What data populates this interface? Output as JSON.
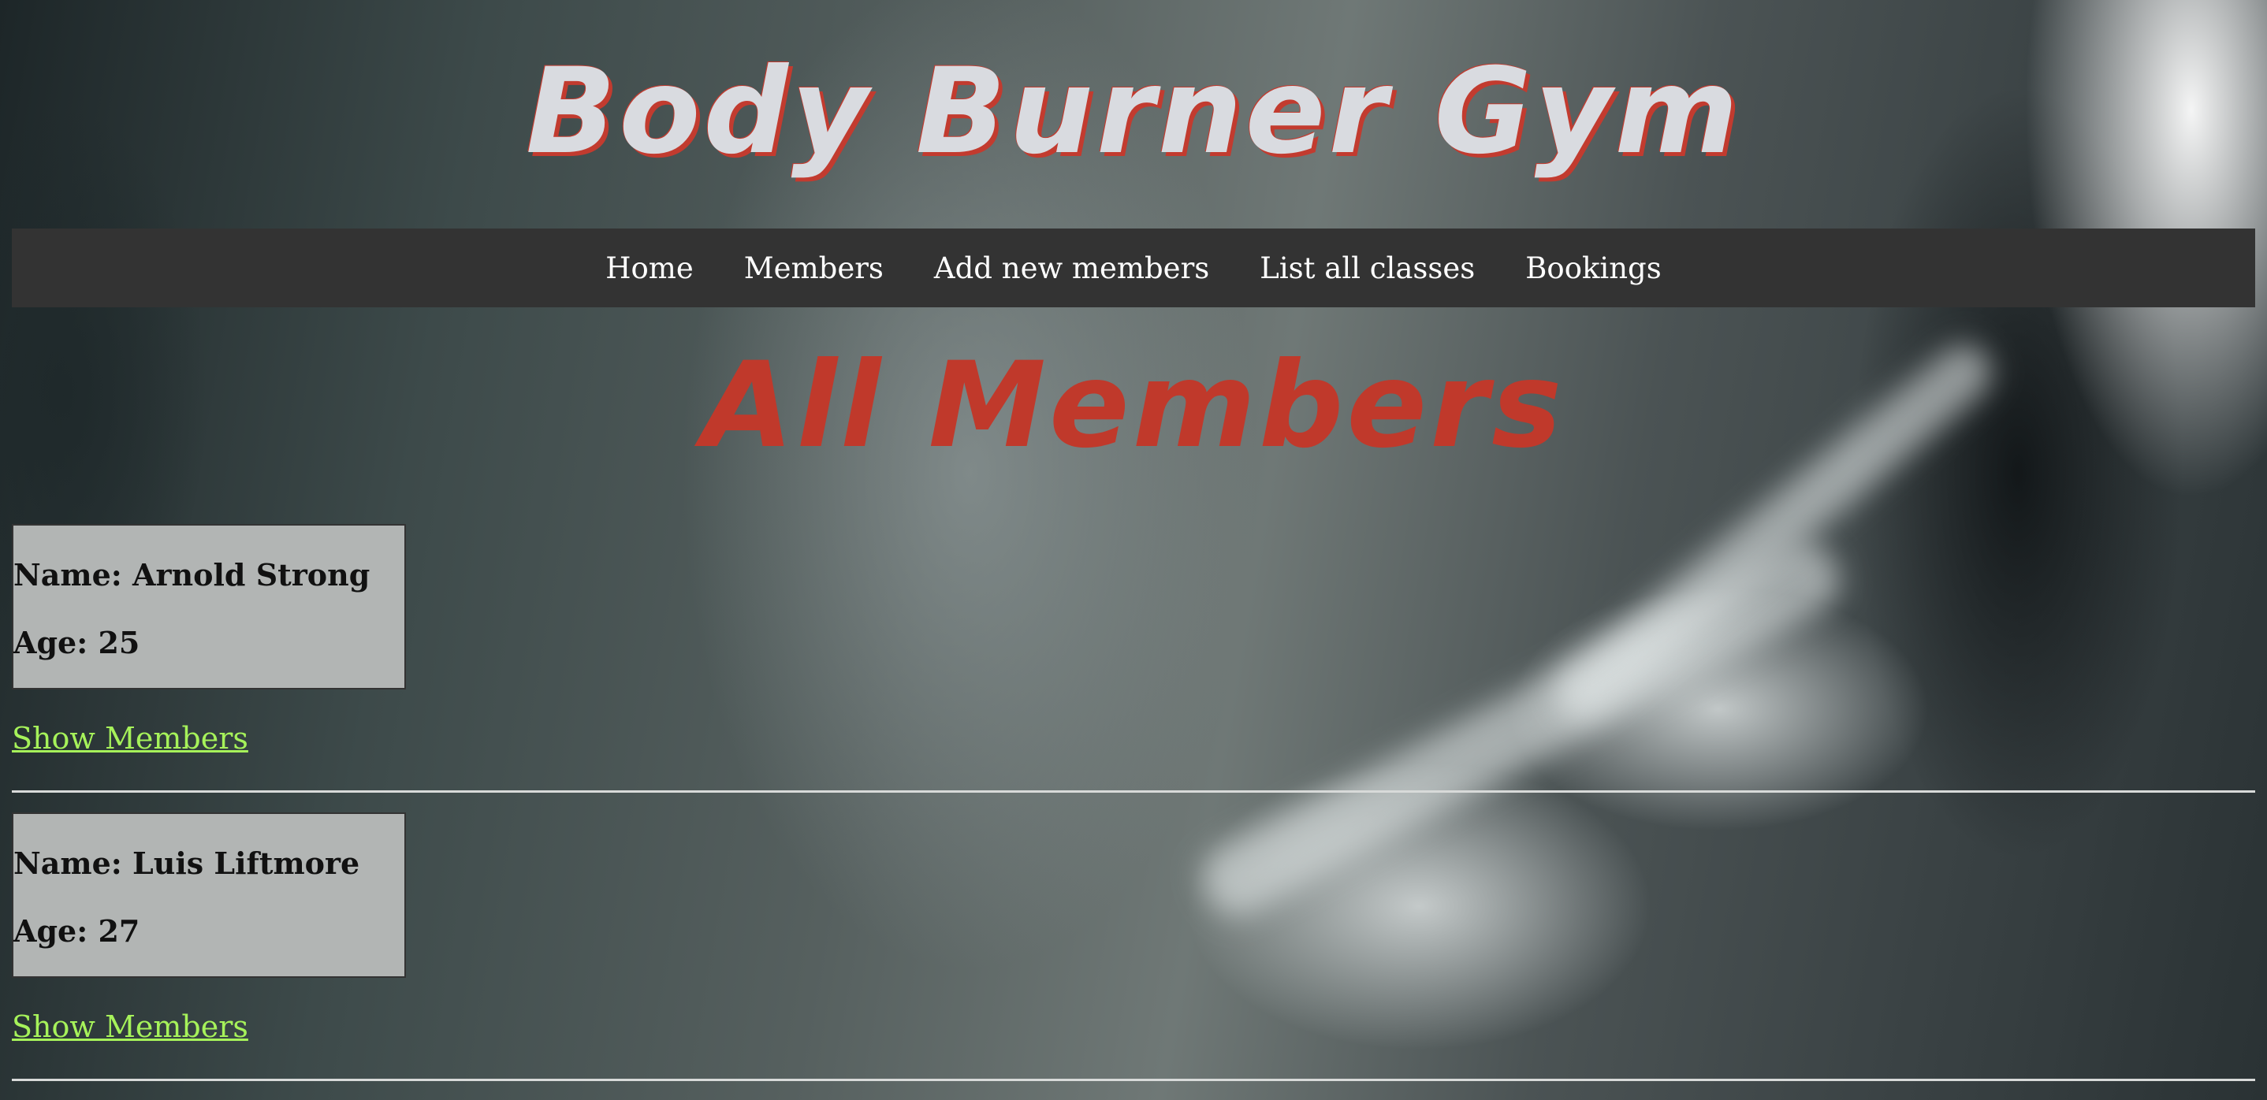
{
  "header": {
    "title": "Body Burner Gym"
  },
  "nav": {
    "items": [
      {
        "label": "Home"
      },
      {
        "label": "Members"
      },
      {
        "label": "Add new members"
      },
      {
        "label": "List all classes"
      },
      {
        "label": "Bookings"
      }
    ]
  },
  "main": {
    "heading": "All Members",
    "members": [
      {
        "name": "Name: Arnold Strong",
        "age": "Age: 25",
        "link": "Show Members"
      },
      {
        "name": "Name: Luis Liftmore",
        "age": "Age: 27",
        "link": "Show Members"
      }
    ]
  },
  "colors": {
    "title_text": "#d9dbe0",
    "title_shadow": "#c23b2f",
    "heading_text": "#c0392b",
    "navbar_bg": "#333333",
    "link_color": "#a6f25a",
    "card_bg": "#b2b5b4"
  }
}
